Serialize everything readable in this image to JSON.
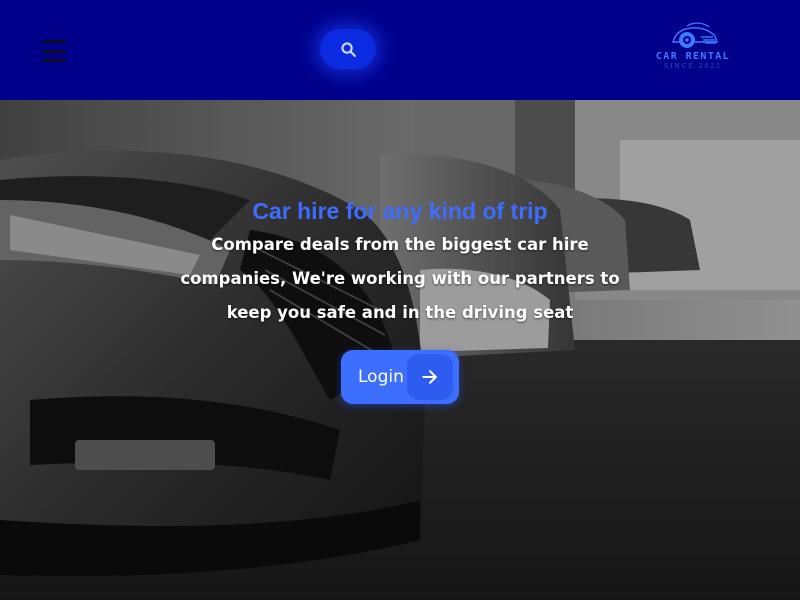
{
  "header": {
    "menu_icon": "hamburger-menu-icon",
    "search_icon": "search-icon",
    "background_color": "#00008b",
    "accent_color": "#0a2be0",
    "logo": {
      "title": "CAR RENTAL",
      "subtitle": "SINCE 2022",
      "icon": "car-logo-icon"
    }
  },
  "hero": {
    "title": "Car hire for any kind of trip",
    "description_lines": [
      "Compare deals from the biggest car hire",
      "companies, We're working with our partners to",
      "keep you safe and in the driving seat"
    ],
    "title_color": "#3d6cff",
    "background_image": "parked-cars-photo",
    "login_button": {
      "label": "Login",
      "icon": "arrow-right-icon",
      "color": "#3c6fff"
    }
  }
}
